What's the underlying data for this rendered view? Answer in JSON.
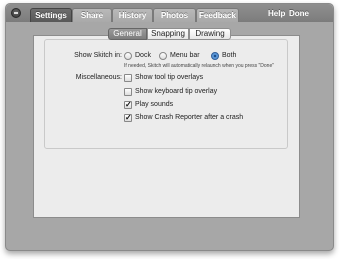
{
  "toolbar": {
    "tabs": [
      {
        "label": "Settings",
        "active": true
      },
      {
        "label": "Share",
        "active": false
      },
      {
        "label": "History",
        "active": false
      },
      {
        "label": "Photos",
        "active": false
      },
      {
        "label": "Feedback",
        "active": false
      }
    ],
    "help_label": "Help",
    "done_label": "Done",
    "close_icon": "close-icon"
  },
  "subtabs": [
    {
      "label": "General",
      "active": true
    },
    {
      "label": "Snapping",
      "active": false
    },
    {
      "label": "Drawing",
      "active": false
    }
  ],
  "general": {
    "show_in_label": "Show Skitch in:",
    "show_in_options": [
      {
        "label": "Dock",
        "selected": false
      },
      {
        "label": "Menu bar",
        "selected": false
      },
      {
        "label": "Both",
        "selected": true
      }
    ],
    "relaunch_note": "If needed, Skitch will automatically relaunch when you press \"Done\"",
    "misc_label": "Miscellaneous:",
    "misc_options": [
      {
        "label": "Show tool tip overlays",
        "checked": false
      },
      {
        "label": "Show keyboard tip overlay",
        "checked": false
      },
      {
        "label": "Play sounds",
        "checked": true
      },
      {
        "label": "Show Crash Reporter after a crash",
        "checked": true
      }
    ]
  },
  "colors": {
    "toolbar": "#858585",
    "window_frame": "#a7a7a7",
    "panel": "#ececec",
    "radio_selected": "#3a73c0"
  }
}
